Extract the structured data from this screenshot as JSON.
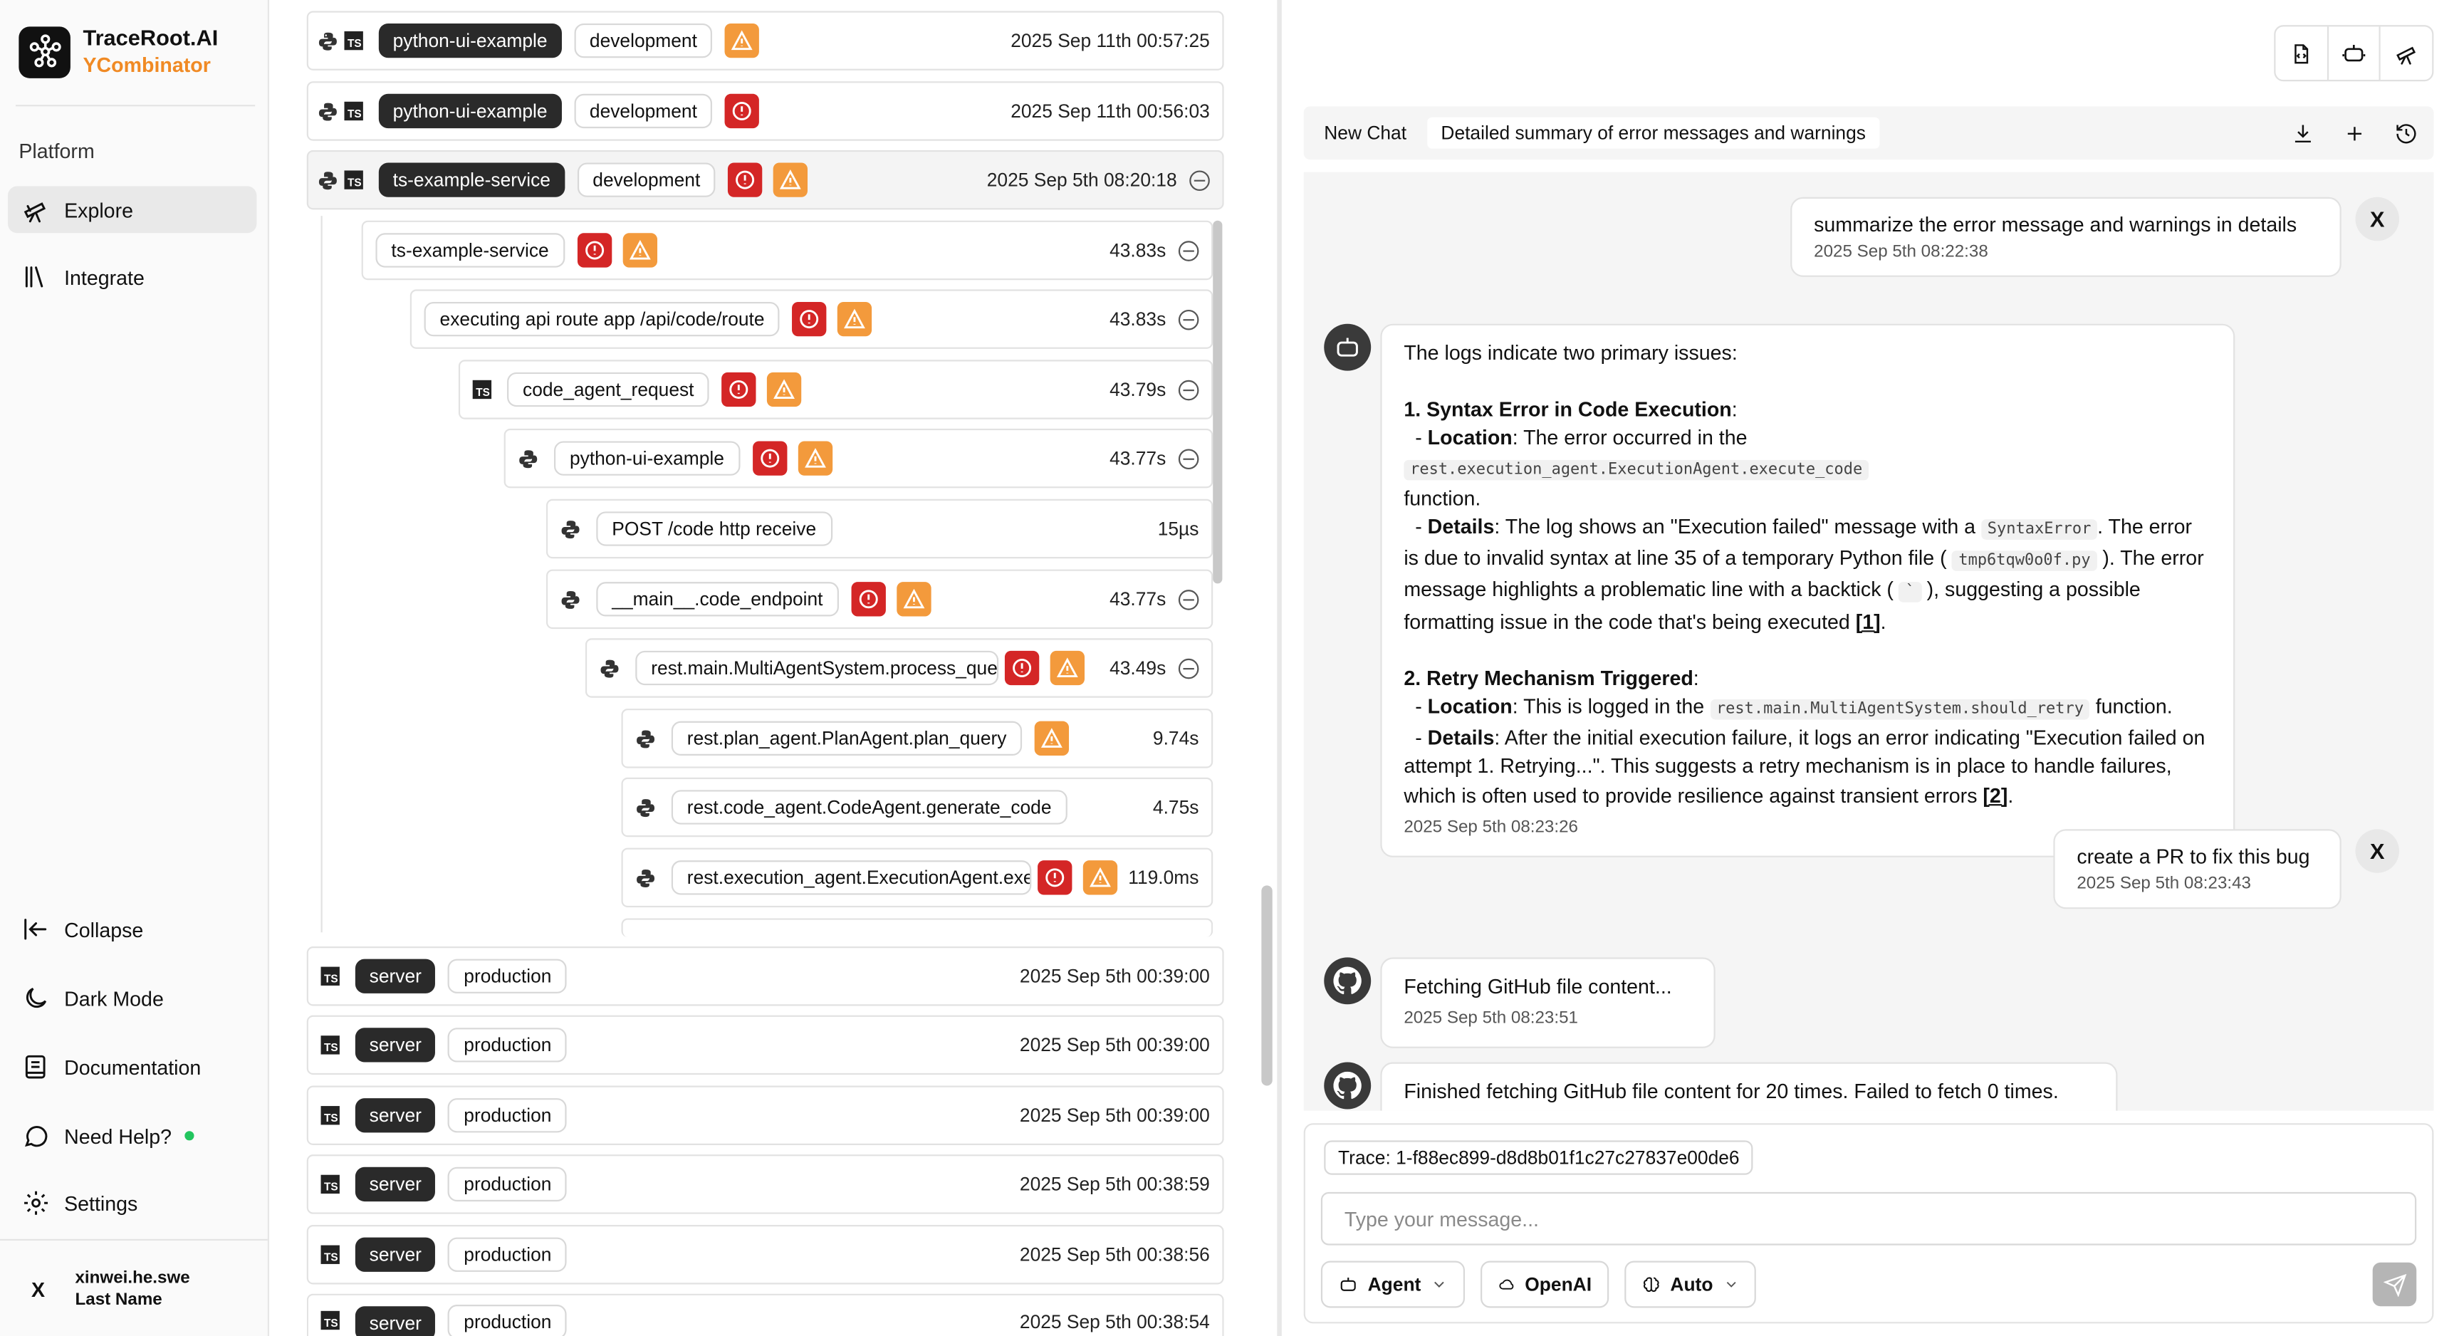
{
  "sidebar": {
    "brand_name": "TraceRoot.AI",
    "brand_sub": "YCombinator",
    "section": "Platform",
    "items": [
      {
        "label": "Explore"
      },
      {
        "label": "Integrate"
      }
    ],
    "bottom": [
      {
        "label": "Collapse"
      },
      {
        "label": "Dark Mode"
      },
      {
        "label": "Documentation"
      },
      {
        "label": "Need Help?"
      },
      {
        "label": "Settings"
      }
    ],
    "user": {
      "x": "X",
      "name": "xinwei.he.swe",
      "last": "Last Name"
    }
  },
  "traces": {
    "top_rows": [
      {
        "service": "python-ui-example",
        "env": "development",
        "time": "2025 Sep 11th 00:57:25"
      },
      {
        "service": "python-ui-example",
        "env": "development",
        "time": "2025 Sep 11th 00:56:03"
      },
      {
        "service": "ts-example-service",
        "env": "development",
        "time": "2025 Sep 5th 08:20:18"
      }
    ],
    "spans": [
      {
        "label": "ts-example-service",
        "dur": "43.83s"
      },
      {
        "label": "executing api route app /api/code/route",
        "dur": "43.83s"
      },
      {
        "label": "code_agent_request",
        "dur": "43.79s"
      },
      {
        "label": "python-ui-example",
        "dur": "43.77s"
      },
      {
        "label": "POST /code http receive",
        "dur": "15µs"
      },
      {
        "label": "__main__.code_endpoint",
        "dur": "43.77s"
      },
      {
        "label": "rest.main.MultiAgentSystem.process_query",
        "dur": "43.49s"
      },
      {
        "label": "rest.plan_agent.PlanAgent.plan_query",
        "dur": "9.74s"
      },
      {
        "label": "rest.code_agent.CodeAgent.generate_code",
        "dur": "4.75s"
      },
      {
        "label": "rest.execution_agent.ExecutionAgent.execute_code",
        "dur": "119.0ms"
      }
    ],
    "bottom_rows": [
      {
        "service": "server",
        "env": "production",
        "time": "2025 Sep 5th 00:39:00"
      },
      {
        "service": "server",
        "env": "production",
        "time": "2025 Sep 5th 00:39:00"
      },
      {
        "service": "server",
        "env": "production",
        "time": "2025 Sep 5th 00:39:00"
      },
      {
        "service": "server",
        "env": "production",
        "time": "2025 Sep 5th 00:38:59"
      },
      {
        "service": "server",
        "env": "production",
        "time": "2025 Sep 5th 00:38:56"
      },
      {
        "service": "server",
        "env": "production",
        "time": "2025 Sep 5th 00:38:54"
      }
    ]
  },
  "chat": {
    "tabs": [
      "New Chat",
      "Detailed summary of error messages and warnings"
    ],
    "messages": {
      "user1": {
        "text": "summarize the error message and warnings in details",
        "ts": "2025 Sep 5th 08:22:38"
      },
      "bot1": {
        "intro": "The logs indicate two primary issues:",
        "h1": "1. Syntax Error in Code Execution",
        "loc_label": "Location",
        "loc1_a": ": The error occurred in the ",
        "loc1_code": "rest.execution_agent.ExecutionAgent.execute_code",
        "loc1_b": "function.",
        "det_label": "Details",
        "det1_a": ": The log shows an \"Execution failed\" message with a ",
        "det1_code": "SyntaxError",
        "det1_b": ". The error is due to invalid syntax at line 35 of a temporary Python file ( ",
        "det1_code2": "tmp6tqw0o0f.py",
        "det1_c": " ). The error message highlights a problematic line with a backtick ( ",
        "det1_code3": "`",
        "det1_d": " ), suggesting a possible formatting issue in the code that's being executed ",
        "ref1": "[1]",
        "h2": "2. Retry Mechanism Triggered",
        "loc2_a": ": This is logged in the ",
        "loc2_code": "rest.main.MultiAgentSystem.should_retry",
        "loc2_b": " function.",
        "det2_a": ": After the initial execution failure, it logs an error indicating \"Execution failed on attempt 1. Retrying...\". This suggests a retry mechanism is in place to handle failures, which is often used to provide resilience against transient errors ",
        "ref2": "[2]",
        "ts": "2025 Sep 5th 08:23:26"
      },
      "user2": {
        "text": "create a PR to fix this bug",
        "ts": "2025 Sep 5th 08:23:43"
      },
      "bot2": {
        "text": "Fetching GitHub file content...",
        "ts": "2025 Sep 5th 08:23:51"
      },
      "bot3": {
        "text": "Finished fetching GitHub file content for 20 times. Failed to fetch 0 times."
      },
      "close_label": "X"
    },
    "composer": {
      "trace_chip": "Trace: 1-f88ec899-d8d8b01f1c27c27837e00de6",
      "placeholder": "Type your message...",
      "mode": "Agent",
      "provider": "OpenAI",
      "model": "Auto"
    }
  },
  "colors": {
    "accent": "#f08a24",
    "error": "#d42626",
    "warning": "#f39a3c",
    "dark_pill": "#2a2a2a"
  }
}
